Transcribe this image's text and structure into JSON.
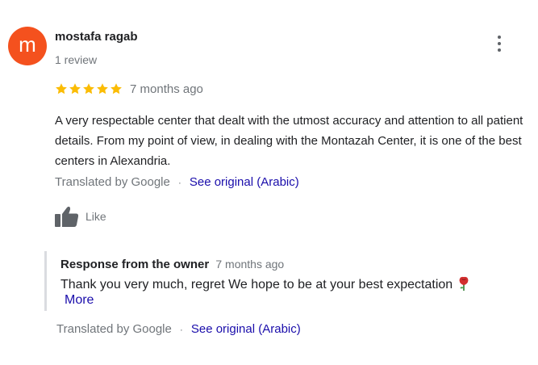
{
  "review": {
    "avatar_letter": "m",
    "author": "mostafa ragab",
    "review_count": "1 review",
    "rating": 5,
    "rating_max": 5,
    "time": "7 months ago",
    "text": "A very respectable center that dealt with the utmost accuracy and attention to all patient details. From my point of view, in dealing with the Montazah Center, it is one of the best centers in Alexandria.",
    "translated_label": "Translated by Google",
    "separator": "·",
    "see_original": "See original (Arabic)",
    "like_label": "Like",
    "icons": {
      "menu": "more-vert-icon",
      "star": "star-icon",
      "like": "thumbs-up-icon",
      "rose": "rose-icon"
    }
  },
  "owner_response": {
    "title": "Response from the owner",
    "time": "7 months ago",
    "text": "Thank you very much, regret We hope to be at your best expectation",
    "more_label": "More",
    "translated_label": "Translated by Google",
    "separator": "·",
    "see_original": "See original (Arabic)"
  },
  "colors": {
    "avatar": "#f4511e",
    "star": "#fbbc04",
    "link": "#1a0dab",
    "secondary_text": "#70757a"
  }
}
